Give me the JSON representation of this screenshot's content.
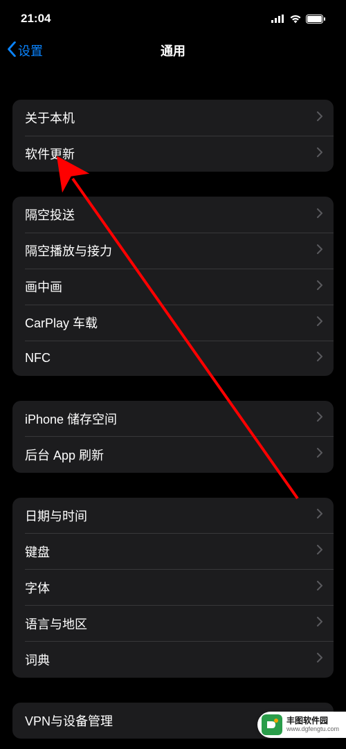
{
  "status": {
    "time": "21:04"
  },
  "nav": {
    "back_label": "设置",
    "title": "通用"
  },
  "groups": [
    {
      "items": [
        {
          "label": "关于本机"
        },
        {
          "label": "软件更新"
        }
      ]
    },
    {
      "items": [
        {
          "label": "隔空投送"
        },
        {
          "label": "隔空播放与接力"
        },
        {
          "label": "画中画"
        },
        {
          "label": "CarPlay 车载"
        },
        {
          "label": "NFC"
        }
      ]
    },
    {
      "items": [
        {
          "label": "iPhone 储存空间"
        },
        {
          "label": "后台 App 刷新"
        }
      ]
    },
    {
      "items": [
        {
          "label": "日期与时间"
        },
        {
          "label": "键盘"
        },
        {
          "label": "字体"
        },
        {
          "label": "语言与地区"
        },
        {
          "label": "词典"
        }
      ]
    },
    {
      "items": [
        {
          "label": "VPN与设备管理"
        }
      ]
    }
  ],
  "watermark": {
    "line1": "丰图软件园",
    "line2": "www.dgfengtu.com"
  }
}
